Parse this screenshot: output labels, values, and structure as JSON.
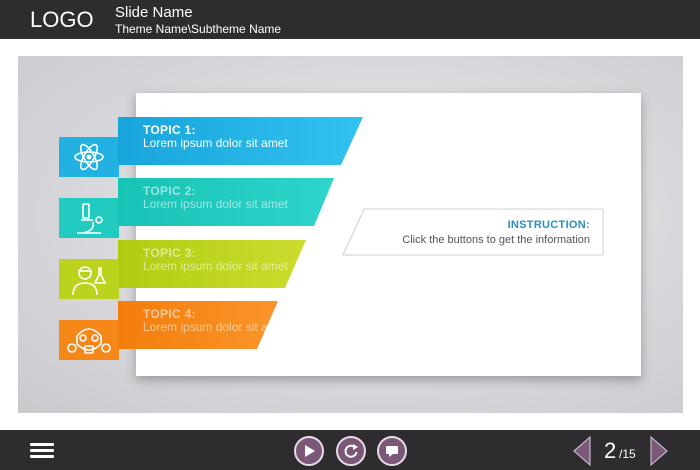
{
  "header": {
    "logo": "LOGO",
    "slide_name": "Slide Name",
    "theme_name": "Theme Name\\Subtheme Name"
  },
  "topics": [
    {
      "title": "TOPIC 1:",
      "desc": "Lorem ipsum dolor sit amet",
      "color": "#22b1e0",
      "icon": "atom-icon"
    },
    {
      "title": "TOPIC 2:",
      "desc": "Lorem ipsum dolor sit amet",
      "color": "#22cbc0",
      "icon": "microscope-icon"
    },
    {
      "title": "TOPIC 3:",
      "desc": "Lorem ipsum dolor sit amet",
      "color": "#bcd31e",
      "icon": "scientist-icon"
    },
    {
      "title": "TOPIC 4:",
      "desc": "Lorem ipsum dolor sit amet",
      "color": "#f6881a",
      "icon": "gas-mask-icon"
    }
  ],
  "instruction": {
    "title": "INSTRUCTION:",
    "text": "Click the buttons to get the information"
  },
  "footer": {
    "menu_icon": "hamburger-menu-icon",
    "controls": [
      "play-icon",
      "replay-icon",
      "subtitles-icon"
    ],
    "page_current": "2",
    "page_total": "/15",
    "accent": "#7b5878"
  }
}
